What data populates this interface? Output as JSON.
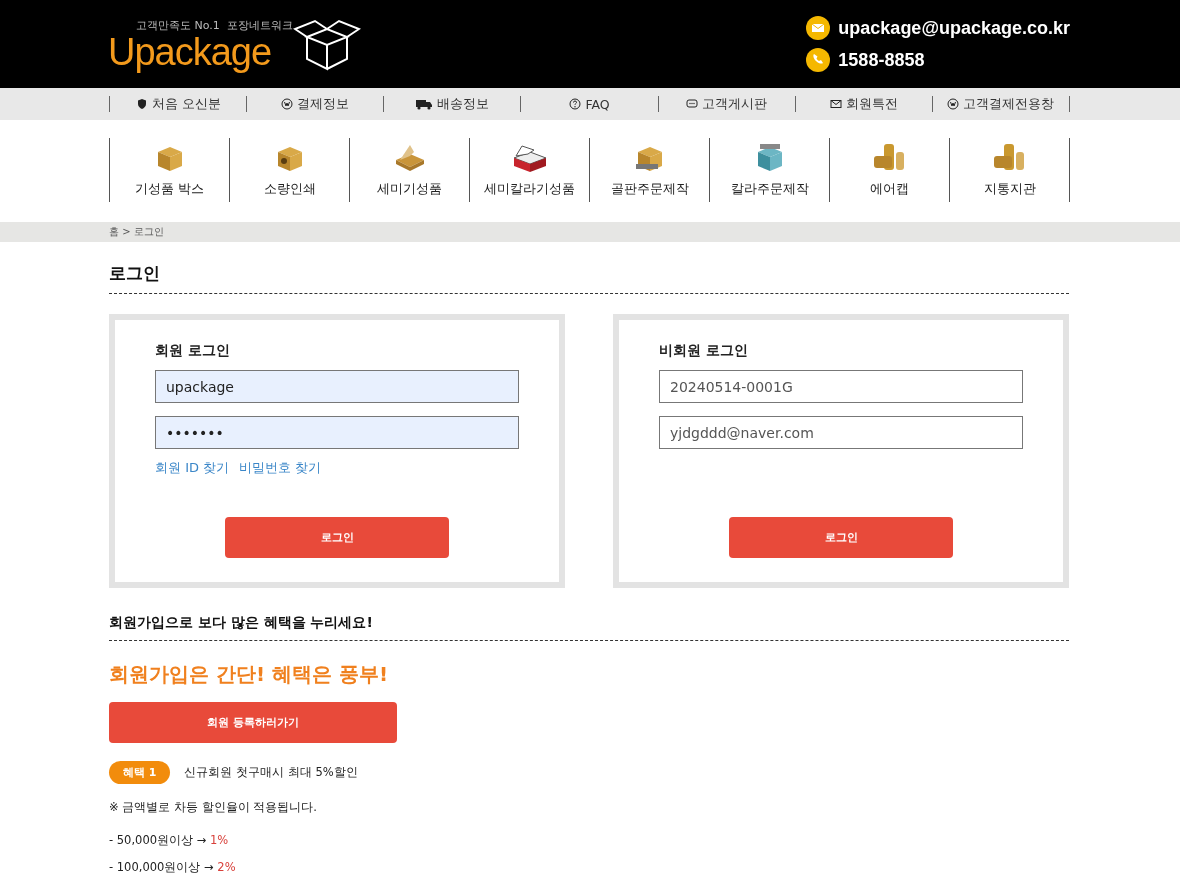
{
  "header": {
    "logo_tagline": "고객만족도 No.1  포장네트워크",
    "logo": "Upackage",
    "email": "upackage@upackage.co.kr",
    "phone": "1588-8858"
  },
  "top_nav": [
    {
      "label": "처음 오신분",
      "kind": "shield"
    },
    {
      "label": "결제정보",
      "kind": "won"
    },
    {
      "label": "배송정보",
      "kind": "truck"
    },
    {
      "label": "FAQ",
      "kind": "question"
    },
    {
      "label": "고객게시판",
      "kind": "chat"
    },
    {
      "label": "회원특전",
      "kind": "mail"
    },
    {
      "label": "고객결제전용창",
      "kind": "won"
    }
  ],
  "categories": [
    {
      "label": "기성품 박스",
      "kind": "box"
    },
    {
      "label": "소량인쇄",
      "kind": "printed"
    },
    {
      "label": "세미기성품",
      "kind": "open"
    },
    {
      "label": "세미칼라기성품",
      "kind": "colored"
    },
    {
      "label": "골판주문제작",
      "kind": "ruler"
    },
    {
      "label": "칼라주문제작",
      "kind": "teal"
    },
    {
      "label": "에어캡",
      "kind": "rolls"
    },
    {
      "label": "지통지관",
      "kind": "rolls"
    }
  ],
  "breadcrumb": "홈 > 로그인",
  "page_title": "로그인",
  "member_login": {
    "title": "회원 로그인",
    "id_value": "upackage",
    "password_value": "•••••••",
    "autofilled": true,
    "links": [
      "회원 ID 찾기",
      "비밀번호 찾기"
    ],
    "button": "로그인"
  },
  "guest_login": {
    "title": "비회원 로그인",
    "order_value": "20240514-0001G",
    "email_value": "yjdgddd@naver.com",
    "autofilled": false,
    "button": "로그인"
  },
  "signup": {
    "heading": "회원가입으로 보다 많은 혜택을 누리세요!",
    "slogan": "회원가입은 간단! 혜택은 풍부!",
    "button": "회원 등록하러가기",
    "badge": "혜택 1",
    "benefit": "신규회원 첫구매시 최대 5%할인",
    "note": "※ 금액별로 차등 할인율이 적용됩니다.",
    "tiers": [
      {
        "amount": "- 50,000원이상 → ",
        "rate": "1%"
      },
      {
        "amount": "- 100,000원이상 → ",
        "rate": "2%"
      }
    ]
  }
}
